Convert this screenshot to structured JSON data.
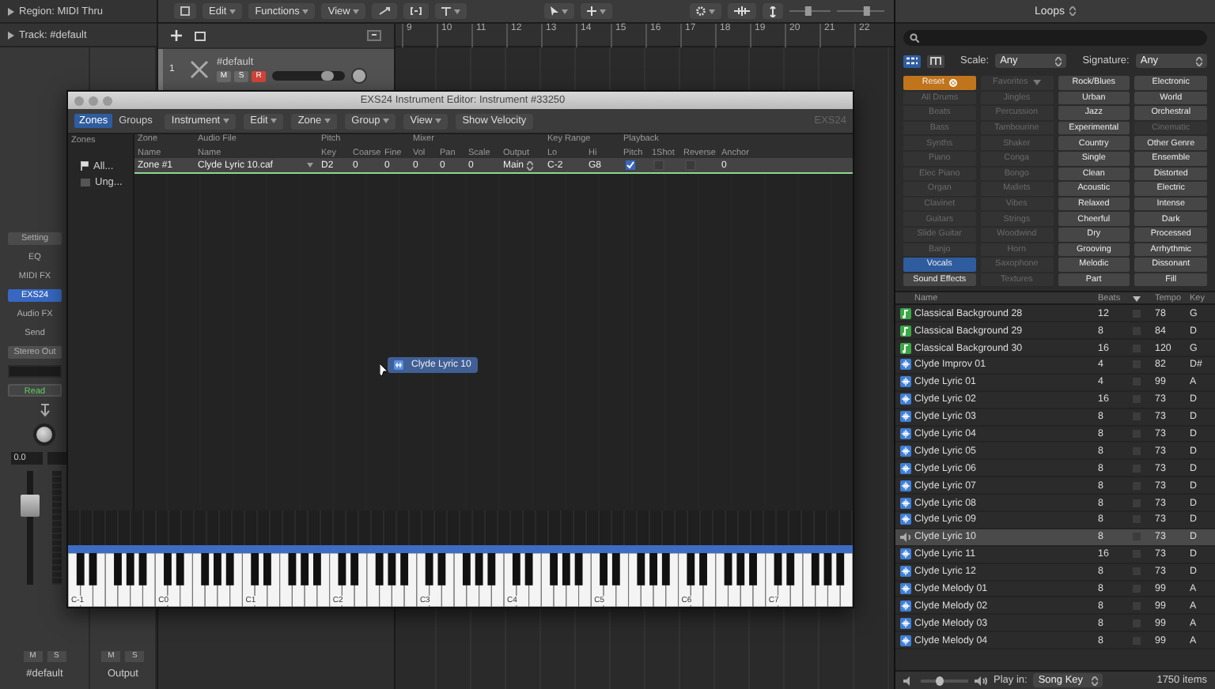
{
  "inspector": {
    "region": "Region: MIDI Thru",
    "track": "Track: #default"
  },
  "strip": {
    "setting": "Setting",
    "slots": [
      {
        "label": "EQ",
        "selected": false
      },
      {
        "label": "MIDI FX",
        "selected": false
      },
      {
        "label": "EXS24",
        "selected": true
      },
      {
        "label": "Audio FX",
        "selected": false
      }
    ],
    "send": "Send",
    "output": "Stereo Out",
    "automation": "Read",
    "pan_value": "0.0",
    "fader": {
      "level": 0.7
    },
    "mute": "M",
    "solo": "S",
    "name": "#default"
  },
  "output_strip": {
    "mute": "M",
    "solo": "S",
    "name": "Output"
  },
  "toolbar": {
    "menus": [
      "Edit",
      "Functions",
      "View"
    ],
    "vertical_zoom": {
      "level": 0.45
    },
    "horizontal_zoom": {
      "level": 0.65
    }
  },
  "track": {
    "number": "1",
    "name": "#default",
    "buttons": [
      {
        "label": "M",
        "on": false
      },
      {
        "label": "S",
        "on": false
      },
      {
        "label": "R",
        "on": true
      }
    ],
    "volume": {
      "level": 0.75
    }
  },
  "ruler": [
    "9",
    "10",
    "11",
    "12",
    "13",
    "14",
    "15",
    "16",
    "17",
    "18",
    "19",
    "20",
    "21",
    "22"
  ],
  "exs": {
    "title": "EXS24 Instrument Editor: Instrument #33250",
    "view_tabs": [
      {
        "label": "Zones",
        "selected": true
      },
      {
        "label": "Groups",
        "selected": false
      }
    ],
    "menus": [
      "Instrument",
      "Edit",
      "Zone",
      "Group",
      "View"
    ],
    "show_velocity": "Show Velocity",
    "logo": "EXS24",
    "zones_header": "Zones",
    "zone_list": [
      {
        "label": "All...",
        "kind": "all"
      },
      {
        "label": "Ung...",
        "kind": "group"
      }
    ],
    "column_groups": [
      {
        "label": "Zone",
        "columns": [
          "Name"
        ]
      },
      {
        "label": "Audio File",
        "columns": [
          "Name"
        ]
      },
      {
        "label": "Pitch",
        "columns": [
          "Key",
          "Coarse",
          "Fine"
        ]
      },
      {
        "label": "Mixer",
        "columns": [
          "Vol",
          "Pan",
          "Scale",
          "Output"
        ]
      },
      {
        "label": "Key Range",
        "columns": [
          "Lo",
          "Hi"
        ]
      },
      {
        "label": "Playback",
        "columns": [
          "Pitch",
          "1Shot",
          "Reverse",
          "Anchor"
        ]
      }
    ],
    "zones": [
      {
        "cells": [
          {
            "kind": "text",
            "value": "Zone #1"
          },
          {
            "kind": "menu",
            "value": "Clyde Lyric 10.caf"
          },
          {
            "kind": "text",
            "value": "D2"
          },
          {
            "kind": "text",
            "value": "0"
          },
          {
            "kind": "text",
            "value": "0"
          },
          {
            "kind": "text",
            "value": "0"
          },
          {
            "kind": "text",
            "value": "0"
          },
          {
            "kind": "text",
            "value": "0"
          },
          {
            "kind": "popup",
            "value": "Main"
          },
          {
            "kind": "text",
            "value": "C-2"
          },
          {
            "kind": "text",
            "value": "G8"
          },
          {
            "kind": "check",
            "checked": true
          },
          {
            "kind": "check",
            "checked": false
          },
          {
            "kind": "check",
            "checked": false
          },
          {
            "kind": "text",
            "value": "0"
          }
        ]
      }
    ],
    "drag_item": "Clyde Lyric 10",
    "octaves": [
      "C-1",
      "C0",
      "C1",
      "C2",
      "C3",
      "C4",
      "C5",
      "C6",
      "C7"
    ]
  },
  "loops": {
    "title": "Loops",
    "views": [
      {
        "kind": "list",
        "selected": true
      },
      {
        "kind": "columns",
        "selected": false
      }
    ],
    "scale": {
      "label": "Scale:",
      "value": "Any"
    },
    "signature": {
      "label": "Signature:",
      "value": "Any"
    },
    "keywords": [
      {
        "label": "Reset",
        "kind": "reset",
        "disabled": false,
        "selected": false
      },
      {
        "label": "Favorites",
        "kind": "favorites",
        "disabled": true,
        "selected": false
      },
      {
        "label": "Rock/Blues",
        "kind": "keyword",
        "disabled": false,
        "selected": false
      },
      {
        "label": "Electronic",
        "kind": "keyword",
        "disabled": false,
        "selected": false
      },
      {
        "label": "All Drums",
        "kind": "keyword",
        "disabled": true,
        "selected": false
      },
      {
        "label": "Jingles",
        "kind": "keyword",
        "disabled": true,
        "selected": false
      },
      {
        "label": "Urban",
        "kind": "keyword",
        "disabled": false,
        "selected": false
      },
      {
        "label": "World",
        "kind": "keyword",
        "disabled": false,
        "selected": false
      },
      {
        "label": "Beats",
        "kind": "keyword",
        "disabled": true,
        "selected": false
      },
      {
        "label": "Percussion",
        "kind": "keyword",
        "disabled": true,
        "selected": false
      },
      {
        "label": "Jazz",
        "kind": "keyword",
        "disabled": false,
        "selected": false
      },
      {
        "label": "Orchestral",
        "kind": "keyword",
        "disabled": false,
        "selected": false
      },
      {
        "label": "Bass",
        "kind": "keyword",
        "disabled": true,
        "selected": false
      },
      {
        "label": "Tambourine",
        "kind": "keyword",
        "disabled": true,
        "selected": false
      },
      {
        "label": "Experimental",
        "kind": "keyword",
        "disabled": false,
        "selected": false
      },
      {
        "label": "Cinematic",
        "kind": "keyword",
        "disabled": true,
        "selected": false
      },
      {
        "label": "Synths",
        "kind": "keyword",
        "disabled": true,
        "selected": false
      },
      {
        "label": "Shaker",
        "kind": "keyword",
        "disabled": true,
        "selected": false
      },
      {
        "label": "Country",
        "kind": "keyword",
        "disabled": false,
        "selected": false
      },
      {
        "label": "Other Genre",
        "kind": "keyword",
        "disabled": false,
        "selected": false
      },
      {
        "label": "Piano",
        "kind": "keyword",
        "disabled": true,
        "selected": false
      },
      {
        "label": "Conga",
        "kind": "keyword",
        "disabled": true,
        "selected": false
      },
      {
        "label": "Single",
        "kind": "keyword",
        "disabled": false,
        "selected": false
      },
      {
        "label": "Ensemble",
        "kind": "keyword",
        "disabled": false,
        "selected": false
      },
      {
        "label": "Elec Piano",
        "kind": "keyword",
        "disabled": true,
        "selected": false
      },
      {
        "label": "Bongo",
        "kind": "keyword",
        "disabled": true,
        "selected": false
      },
      {
        "label": "Clean",
        "kind": "keyword",
        "disabled": false,
        "selected": false
      },
      {
        "label": "Distorted",
        "kind": "keyword",
        "disabled": false,
        "selected": false
      },
      {
        "label": "Organ",
        "kind": "keyword",
        "disabled": true,
        "selected": false
      },
      {
        "label": "Mallets",
        "kind": "keyword",
        "disabled": true,
        "selected": false
      },
      {
        "label": "Acoustic",
        "kind": "keyword",
        "disabled": false,
        "selected": false
      },
      {
        "label": "Electric",
        "kind": "keyword",
        "disabled": false,
        "selected": false
      },
      {
        "label": "Clavinet",
        "kind": "keyword",
        "disabled": true,
        "selected": false
      },
      {
        "label": "Vibes",
        "kind": "keyword",
        "disabled": true,
        "selected": false
      },
      {
        "label": "Relaxed",
        "kind": "keyword",
        "disabled": false,
        "selected": false
      },
      {
        "label": "Intense",
        "kind": "keyword",
        "disabled": false,
        "selected": false
      },
      {
        "label": "Guitars",
        "kind": "keyword",
        "disabled": true,
        "selected": false
      },
      {
        "label": "Strings",
        "kind": "keyword",
        "disabled": true,
        "selected": false
      },
      {
        "label": "Cheerful",
        "kind": "keyword",
        "disabled": false,
        "selected": false
      },
      {
        "label": "Dark",
        "kind": "keyword",
        "disabled": false,
        "selected": false
      },
      {
        "label": "Slide Guitar",
        "kind": "keyword",
        "disabled": true,
        "selected": false
      },
      {
        "label": "Woodwind",
        "kind": "keyword",
        "disabled": true,
        "selected": false
      },
      {
        "label": "Dry",
        "kind": "keyword",
        "disabled": false,
        "selected": false
      },
      {
        "label": "Processed",
        "kind": "keyword",
        "disabled": false,
        "selected": false
      },
      {
        "label": "Banjo",
        "kind": "keyword",
        "disabled": true,
        "selected": false
      },
      {
        "label": "Horn",
        "kind": "keyword",
        "disabled": true,
        "selected": false
      },
      {
        "label": "Grooving",
        "kind": "keyword",
        "disabled": false,
        "selected": false
      },
      {
        "label": "Arrhythmic",
        "kind": "keyword",
        "disabled": false,
        "selected": false
      },
      {
        "label": "Vocals",
        "kind": "keyword",
        "disabled": false,
        "selected": true
      },
      {
        "label": "Saxophone",
        "kind": "keyword",
        "disabled": true,
        "selected": false
      },
      {
        "label": "Melodic",
        "kind": "keyword",
        "disabled": false,
        "selected": false
      },
      {
        "label": "Dissonant",
        "kind": "keyword",
        "disabled": false,
        "selected": false
      },
      {
        "label": "Sound Effects",
        "kind": "keyword",
        "disabled": false,
        "selected": false
      },
      {
        "label": "Textures",
        "kind": "keyword",
        "disabled": true,
        "selected": false
      },
      {
        "label": "Part",
        "kind": "keyword",
        "disabled": false,
        "selected": false
      },
      {
        "label": "Fill",
        "kind": "keyword",
        "disabled": false,
        "selected": false
      }
    ],
    "columns": {
      "name": "Name",
      "beats": "Beats",
      "tempo": "Tempo",
      "key": "Key"
    },
    "rows": [
      {
        "name": "Classical Background 28",
        "beats": "12",
        "tempo": "78",
        "key": "G",
        "kind": "midi",
        "selected": false,
        "favorite": false
      },
      {
        "name": "Classical Background 29",
        "beats": "8",
        "tempo": "84",
        "key": "D",
        "kind": "midi",
        "selected": false,
        "favorite": false
      },
      {
        "name": "Classical Background 30",
        "beats": "16",
        "tempo": "120",
        "key": "G",
        "kind": "midi",
        "selected": false,
        "favorite": false
      },
      {
        "name": "Clyde Improv 01",
        "beats": "4",
        "tempo": "82",
        "key": "D#",
        "kind": "audio",
        "selected": false,
        "favorite": false
      },
      {
        "name": "Clyde Lyric 01",
        "beats": "4",
        "tempo": "99",
        "key": "A",
        "kind": "audio",
        "selected": false,
        "favorite": false
      },
      {
        "name": "Clyde Lyric 02",
        "beats": "16",
        "tempo": "73",
        "key": "D",
        "kind": "audio",
        "selected": false,
        "favorite": false
      },
      {
        "name": "Clyde Lyric 03",
        "beats": "8",
        "tempo": "73",
        "key": "D",
        "kind": "audio",
        "selected": false,
        "favorite": false
      },
      {
        "name": "Clyde Lyric 04",
        "beats": "8",
        "tempo": "73",
        "key": "D",
        "kind": "audio",
        "selected": false,
        "favorite": false
      },
      {
        "name": "Clyde Lyric 05",
        "beats": "8",
        "tempo": "73",
        "key": "D",
        "kind": "audio",
        "selected": false,
        "favorite": false
      },
      {
        "name": "Clyde Lyric 06",
        "beats": "8",
        "tempo": "73",
        "key": "D",
        "kind": "audio",
        "selected": false,
        "favorite": false
      },
      {
        "name": "Clyde Lyric 07",
        "beats": "8",
        "tempo": "73",
        "key": "D",
        "kind": "audio",
        "selected": false,
        "favorite": false
      },
      {
        "name": "Clyde Lyric 08",
        "beats": "8",
        "tempo": "73",
        "key": "D",
        "kind": "audio",
        "selected": false,
        "favorite": false
      },
      {
        "name": "Clyde Lyric 09",
        "beats": "8",
        "tempo": "73",
        "key": "D",
        "kind": "audio",
        "selected": false,
        "favorite": false
      },
      {
        "name": "Clyde Lyric 10",
        "beats": "8",
        "tempo": "73",
        "key": "D",
        "kind": "preview",
        "selected": true,
        "favorite": false
      },
      {
        "name": "Clyde Lyric 11",
        "beats": "16",
        "tempo": "73",
        "key": "D",
        "kind": "audio",
        "selected": false,
        "favorite": false
      },
      {
        "name": "Clyde Lyric 12",
        "beats": "8",
        "tempo": "73",
        "key": "D",
        "kind": "audio",
        "selected": false,
        "favorite": false
      },
      {
        "name": "Clyde Melody 01",
        "beats": "8",
        "tempo": "99",
        "key": "A",
        "kind": "audio",
        "selected": false,
        "favorite": false
      },
      {
        "name": "Clyde Melody 02",
        "beats": "8",
        "tempo": "99",
        "key": "A",
        "kind": "audio",
        "selected": false,
        "favorite": false
      },
      {
        "name": "Clyde Melody 03",
        "beats": "8",
        "tempo": "99",
        "key": "A",
        "kind": "audio",
        "selected": false,
        "favorite": false
      },
      {
        "name": "Clyde Melody 04",
        "beats": "8",
        "tempo": "99",
        "key": "A",
        "kind": "audio",
        "selected": false,
        "favorite": false
      }
    ],
    "footer": {
      "volume": {
        "level": 0.4
      },
      "play_in": "Play in:",
      "key_mode": "Song Key",
      "count": "1750 items"
    }
  }
}
